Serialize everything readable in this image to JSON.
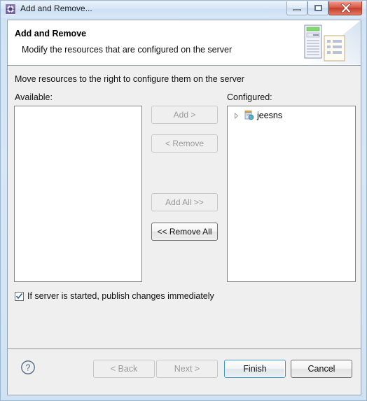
{
  "window": {
    "title": "Add and Remove...",
    "icon": "cog-icon",
    "controls": {
      "minimize": "minimize-icon",
      "maximize": "restore-icon",
      "close": "close-icon"
    }
  },
  "header": {
    "title": "Add and Remove",
    "description": "Modify the resources that are configured on the server",
    "art": "server-and-document-icon"
  },
  "content": {
    "instruction": "Move resources to the right to configure them on the server",
    "available_label": "Available:",
    "configured_label": "Configured:",
    "available_items": [],
    "configured_items": [
      {
        "label": "jeesns",
        "icon": "module-icon",
        "expanded": false,
        "arrow": "chevron-right-icon"
      }
    ]
  },
  "transfer_buttons": [
    {
      "id": "add",
      "label": "Add >",
      "enabled": false
    },
    {
      "id": "remove",
      "label": "< Remove",
      "enabled": false
    },
    {
      "id": "add-all",
      "label": "Add All >>",
      "enabled": false
    },
    {
      "id": "remove-all",
      "label": "<< Remove All",
      "enabled": true
    }
  ],
  "publish": {
    "label": "If server is started, publish changes immediately",
    "checked": true
  },
  "footer": {
    "help": "help-icon",
    "buttons": [
      {
        "id": "back",
        "label": "< Back",
        "enabled": false,
        "default": false
      },
      {
        "id": "next",
        "label": "Next >",
        "enabled": false,
        "default": false
      },
      {
        "id": "finish",
        "label": "Finish",
        "enabled": true,
        "default": true
      },
      {
        "id": "cancel",
        "label": "Cancel",
        "enabled": true,
        "default": false
      }
    ]
  },
  "colors": {
    "accent": "#3c9bd0",
    "close_button": "#c43f2c",
    "title_bar": "#d6e6f6",
    "dialog_bg": "#efefef",
    "list_bg": "#ffffff",
    "border": "#848484",
    "disabled_text": "#9a9a9a"
  }
}
